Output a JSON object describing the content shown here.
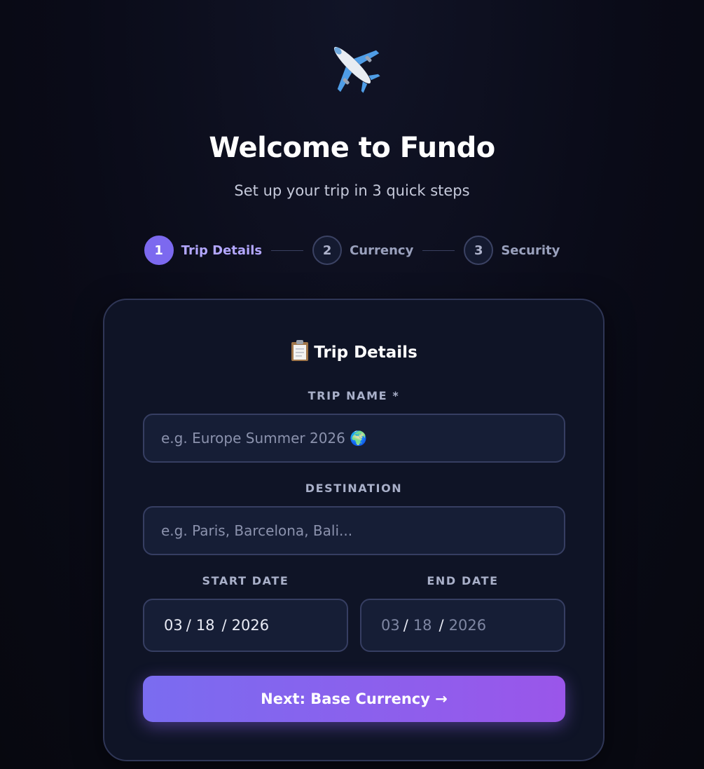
{
  "hero": {
    "icon": "airplane-icon"
  },
  "header": {
    "title": "Welcome to Fundo",
    "subtitle": "Set up your trip in 3 quick steps"
  },
  "stepper": {
    "steps": [
      {
        "number": "1",
        "label": "Trip Details",
        "active": true
      },
      {
        "number": "2",
        "label": "Currency",
        "active": false
      },
      {
        "number": "3",
        "label": "Security",
        "active": false
      }
    ]
  },
  "card": {
    "title": "Trip Details",
    "title_icon": "clipboard-icon",
    "trip_name": {
      "label": "TRIP NAME *",
      "value": "",
      "placeholder": "e.g. Europe Summer 2026 🌍"
    },
    "destination": {
      "label": "DESTINATION",
      "value": "",
      "placeholder": "e.g. Paris, Barcelona, Bali..."
    },
    "start_date": {
      "label": "START DATE",
      "month": "03",
      "day": "18",
      "year": "2026"
    },
    "end_date": {
      "label": "END DATE",
      "month": "03",
      "day": "18",
      "year": "2026"
    },
    "next_button": "Next: Base Currency →"
  },
  "colors": {
    "accent": "#7c69ef",
    "button_gradient_start": "#7a6cf0",
    "button_gradient_end": "#9a56ea",
    "background": "#0a0b18",
    "card": "#0f1426"
  }
}
